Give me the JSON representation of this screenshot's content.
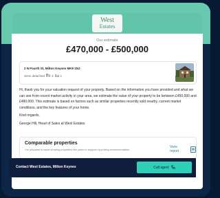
{
  "brand": {
    "logo_line1": "West",
    "logo_line2": "Estates",
    "accent": "#62c4a8",
    "dark": "#0f1e3d"
  },
  "estimate": {
    "label": "Our estimate",
    "value": "£470,000 - £500,000"
  },
  "property": {
    "address": "2 N Fourth St, Milton Keynes MK9 1NJ",
    "type": "Semi detached",
    "bedrooms": "3",
    "bathrooms": "1",
    "bed_icon": "bed-icon",
    "bath_icon": "bath-icon"
  },
  "message": {
    "paragraph": "Hi, thank you for your valuation request of your property. Based on the information you have provided and what we can see from recent market activity in your area, we estimate the value of your property to be between £450,000 and £480,000. This estimate is based on factors such as similar properties recently sold nearby, current market conditions, and the key features of your home.",
    "regards": "Kind regards,",
    "signature": "George Hill, Head of Sales at West Estates"
  },
  "comparable": {
    "title": "Comparable properties",
    "description": "I’ve prepared a report showing properties like yours to support my pricing recommendation.",
    "link_label": "View report",
    "link_icon": "document-icon"
  },
  "contact": {
    "label": "Contact West Estates, Milton Keynes",
    "button_label": "Call agent",
    "button_icon": "phone-icon"
  }
}
